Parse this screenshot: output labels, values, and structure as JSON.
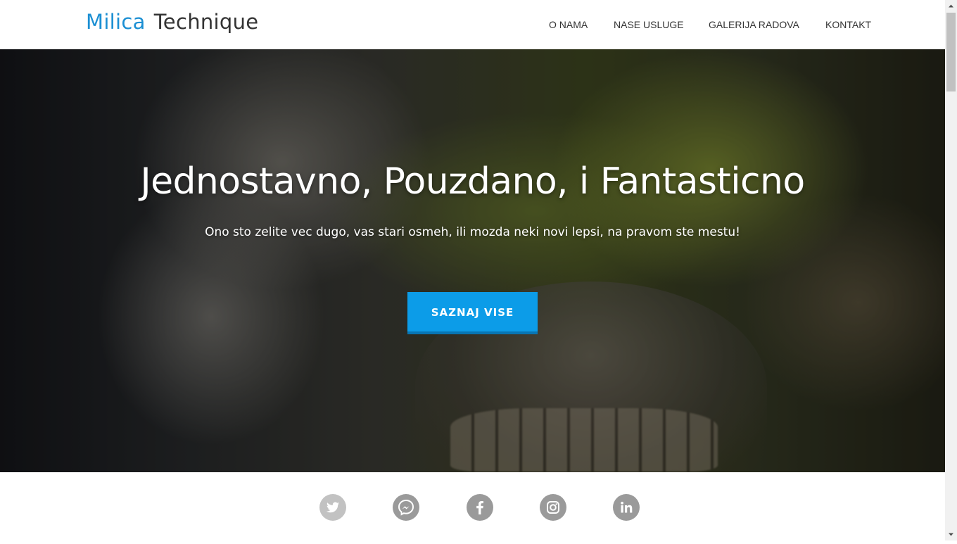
{
  "header": {
    "logo_accent": "Milica",
    "logo_rest": "Technique",
    "nav": [
      {
        "label": "O NAMA"
      },
      {
        "label": "NASE USLUGE"
      },
      {
        "label": "GALERIJA RADOVA"
      },
      {
        "label": "KONTAKT"
      }
    ]
  },
  "hero": {
    "title": "Jednostavno, Pouzdano, i Fantasticno",
    "subtitle": "Ono sto zelite vec dugo, vas stari osmeh, ili mozda neki novi lepsi, na pravom ste mestu!",
    "cta_label": "SAZNAJ VISE"
  },
  "social": [
    {
      "icon": "twitter-icon"
    },
    {
      "icon": "messenger-icon"
    },
    {
      "icon": "facebook-icon"
    },
    {
      "icon": "instagram-icon"
    },
    {
      "icon": "linkedin-icon"
    }
  ],
  "colors": {
    "accent": "#1b8fd3",
    "cta": "#0c9ce8",
    "text_dark": "#333333",
    "social_icon": "#9a9a9a"
  }
}
